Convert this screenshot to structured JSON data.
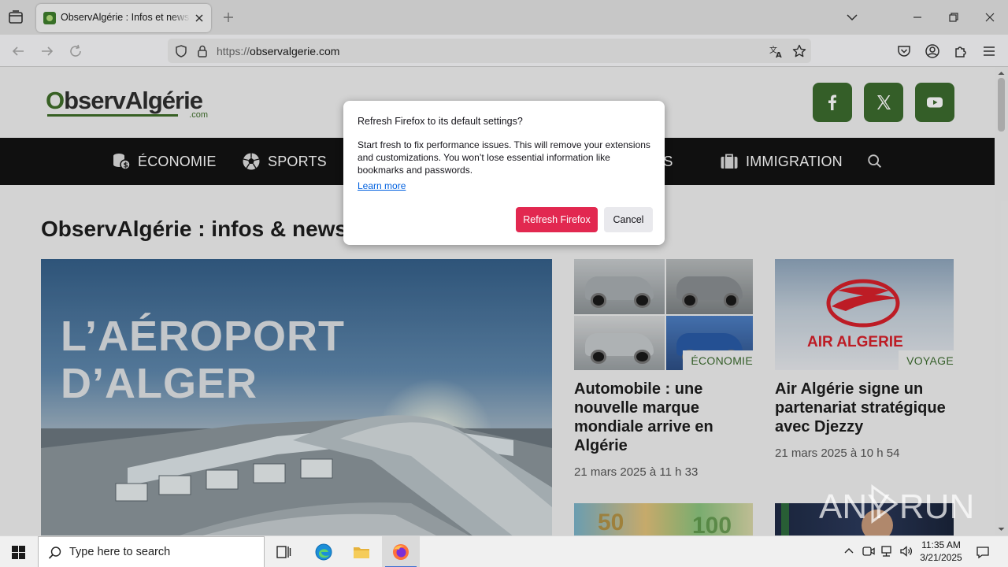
{
  "browser": {
    "tab_title": "ObservAlgérie : Infos et news p",
    "url_prefix": "https://",
    "url_domain": "observalgerie.com"
  },
  "site": {
    "logo_text_o": "O",
    "logo_text_rest": "bservAlgérie",
    "logo_dotcom": ".com",
    "menu": [
      {
        "label": "ÉCONOMIE",
        "icon": "coins-icon"
      },
      {
        "label": "SPORTS",
        "icon": "soccer-ball-icon"
      },
      {
        "label": "ERS",
        "icon": ""
      },
      {
        "label": "IMMIGRATION",
        "icon": "suitcase-icon"
      }
    ],
    "page_heading": "ObservAlgérie : infos & news",
    "hero": {
      "line1": "L’AÉROPORT",
      "line2": "D’ALGER"
    },
    "cards": [
      {
        "category": "ÉCONOMIE",
        "title": "Automobile : une nouvelle marque mondiale arrive en Algérie",
        "date": "21 mars 2025 à 11 h 33"
      },
      {
        "category": "VOYAGE",
        "title": "Air Algérie signe un partenariat stratégique avec Djezzy",
        "date": "21 mars 2025 à 10 h 54",
        "brand": "AIR ALGERIE"
      }
    ],
    "colors": {
      "brand_green": "#3c6b2e",
      "menu_bg": "#131313",
      "air_algerie_red": "#d8202b"
    }
  },
  "dialog": {
    "title": "Refresh Firefox to its default settings?",
    "body": "Start fresh to fix performance issues. This will remove your extensions and customizations. You won’t lose essential information like bookmarks and passwords.",
    "link": "Learn more",
    "primary": "Refresh Firefox",
    "secondary": "Cancel",
    "primary_color": "#e22850"
  },
  "watermark": "ANY RUN",
  "taskbar": {
    "search_placeholder": "Type here to search",
    "time": "11:35 AM",
    "date": "3/21/2025"
  }
}
